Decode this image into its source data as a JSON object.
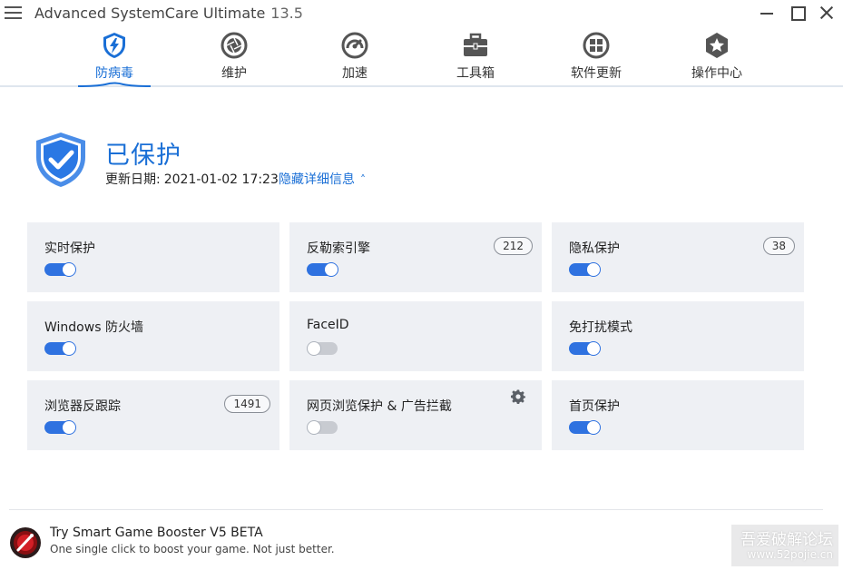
{
  "app": {
    "title": "Advanced SystemCare Ultimate",
    "version": "13.5"
  },
  "nav": {
    "tabs": [
      {
        "label": "防病毒",
        "icon": "shield-bolt-icon",
        "active": true
      },
      {
        "label": "维护",
        "icon": "aperture-icon",
        "active": false
      },
      {
        "label": "加速",
        "icon": "speedometer-icon",
        "active": false
      },
      {
        "label": "工具箱",
        "icon": "toolbox-icon",
        "active": false
      },
      {
        "label": "软件更新",
        "icon": "apps-grid-icon",
        "active": false
      },
      {
        "label": "操作中心",
        "icon": "star-badge-icon",
        "active": false
      }
    ]
  },
  "status": {
    "title": "已保护",
    "date_label": "更新日期:",
    "date_value": "2021-01-02 17:23",
    "detail_link": "隐藏详细信息"
  },
  "features": [
    {
      "title": "实时保护",
      "enabled": true,
      "badge": null
    },
    {
      "title": "反勒索引擎",
      "enabled": true,
      "badge": "212"
    },
    {
      "title": "隐私保护",
      "enabled": true,
      "badge": "38"
    },
    {
      "title": "Windows 防火墙",
      "enabled": true,
      "badge": null
    },
    {
      "title": "FaceID",
      "enabled": false,
      "badge": null
    },
    {
      "title": "免打扰模式",
      "enabled": true,
      "badge": null
    },
    {
      "title": "浏览器反跟踪",
      "enabled": true,
      "badge": "1491"
    },
    {
      "title": "网页浏览保护 & 广告拦截",
      "enabled": false,
      "badge": null,
      "settings": true
    },
    {
      "title": "首页保护",
      "enabled": true,
      "badge": null
    }
  ],
  "promo": {
    "title": "Try Smart Game Booster V5 BETA",
    "subtitle": "One single click to boost your game. Not just better."
  },
  "watermark": {
    "line1": "吾爱破解论坛",
    "line2": "www.52pojie.cn"
  },
  "colors": {
    "accent": "#1a6fd6",
    "toggle_on": "#2f72e0",
    "card_bg": "#eef0f4"
  }
}
